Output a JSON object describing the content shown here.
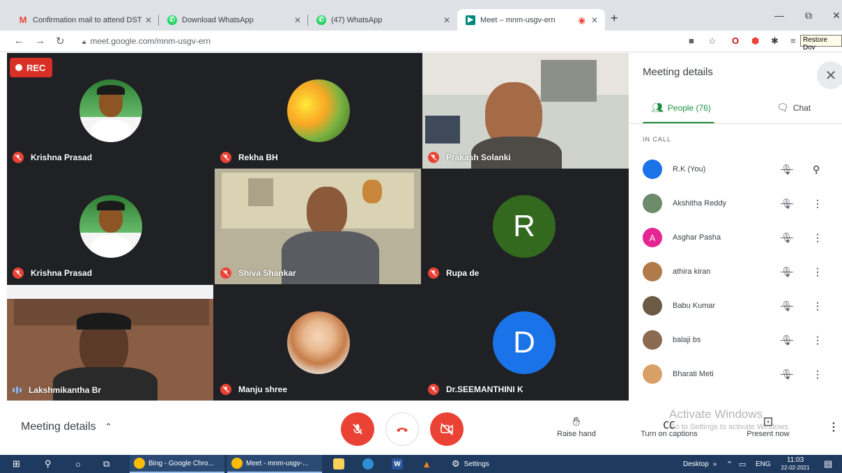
{
  "browser": {
    "tabs": [
      {
        "title": "Confirmation mail to attend DST",
        "icon": "gmail-icon",
        "active": false
      },
      {
        "title": "Download WhatsApp",
        "icon": "whatsapp-icon",
        "active": false
      },
      {
        "title": "(47) WhatsApp",
        "icon": "whatsapp-icon",
        "active": false
      },
      {
        "title": "Meet – mnm-usgv-ern",
        "icon": "meet-icon",
        "active": true
      }
    ],
    "new_tab": "+",
    "url": "meet.google.com/mnm-usgv-ern",
    "restore_tooltip": "Restore Dov"
  },
  "recording": {
    "label": "REC"
  },
  "tiles": [
    {
      "name": "Krishna Prasad",
      "muted": true
    },
    {
      "name": "Rekha BH",
      "muted": true
    },
    {
      "name": "Prakash Solanki",
      "muted": true
    },
    {
      "name": "Krishna Prasad",
      "muted": true
    },
    {
      "name": "Shiva Shankar",
      "muted": true
    },
    {
      "name": "Rupa de",
      "muted": true,
      "letter": "R",
      "color": "#33691e"
    },
    {
      "name": "Lakshmikantha Br",
      "muted": false,
      "speaking": true
    },
    {
      "name": "Manju shree",
      "muted": true
    },
    {
      "name": "Dr.SEEMANTHINI K",
      "muted": true,
      "letter": "D",
      "color": "#1a73e8"
    }
  ],
  "panel": {
    "title": "Meeting details",
    "tab_people": "People (76)",
    "tab_chat": "Chat",
    "section": "IN CALL",
    "people": [
      {
        "name": "R.K (You)",
        "avatar_color": "#1a73e8",
        "letter": ""
      },
      {
        "name": "Akshitha Reddy",
        "avatar_color": "#6d8a6a",
        "letter": ""
      },
      {
        "name": "Asghar Pasha",
        "avatar_color": "#e52592",
        "letter": "A"
      },
      {
        "name": "athira kiran",
        "avatar_color": "#b07a4a",
        "letter": ""
      },
      {
        "name": "Babu Kumar",
        "avatar_color": "#6b5a44",
        "letter": ""
      },
      {
        "name": "balaji bs",
        "avatar_color": "#8a6a50",
        "letter": ""
      },
      {
        "name": "Bharati Meti",
        "avatar_color": "#d9a066",
        "letter": ""
      }
    ]
  },
  "controls": {
    "meeting_details": "Meeting details",
    "raise_hand": "Raise hand",
    "captions": "Turn on captions",
    "present": "Present now",
    "watermark_title": "Activate Windows",
    "watermark_sub": "Go to Settings to activate Windows.",
    "mic_color": "#ea4335",
    "hangup_color": "#ea4335"
  },
  "taskbar": {
    "items": [
      "Bing - Google Chro...",
      "Meet - mnm-usgv-...",
      "Settings"
    ],
    "desktop": "Desktop",
    "lang": "ENG",
    "time": "11:03",
    "date": "22-02-2021"
  }
}
